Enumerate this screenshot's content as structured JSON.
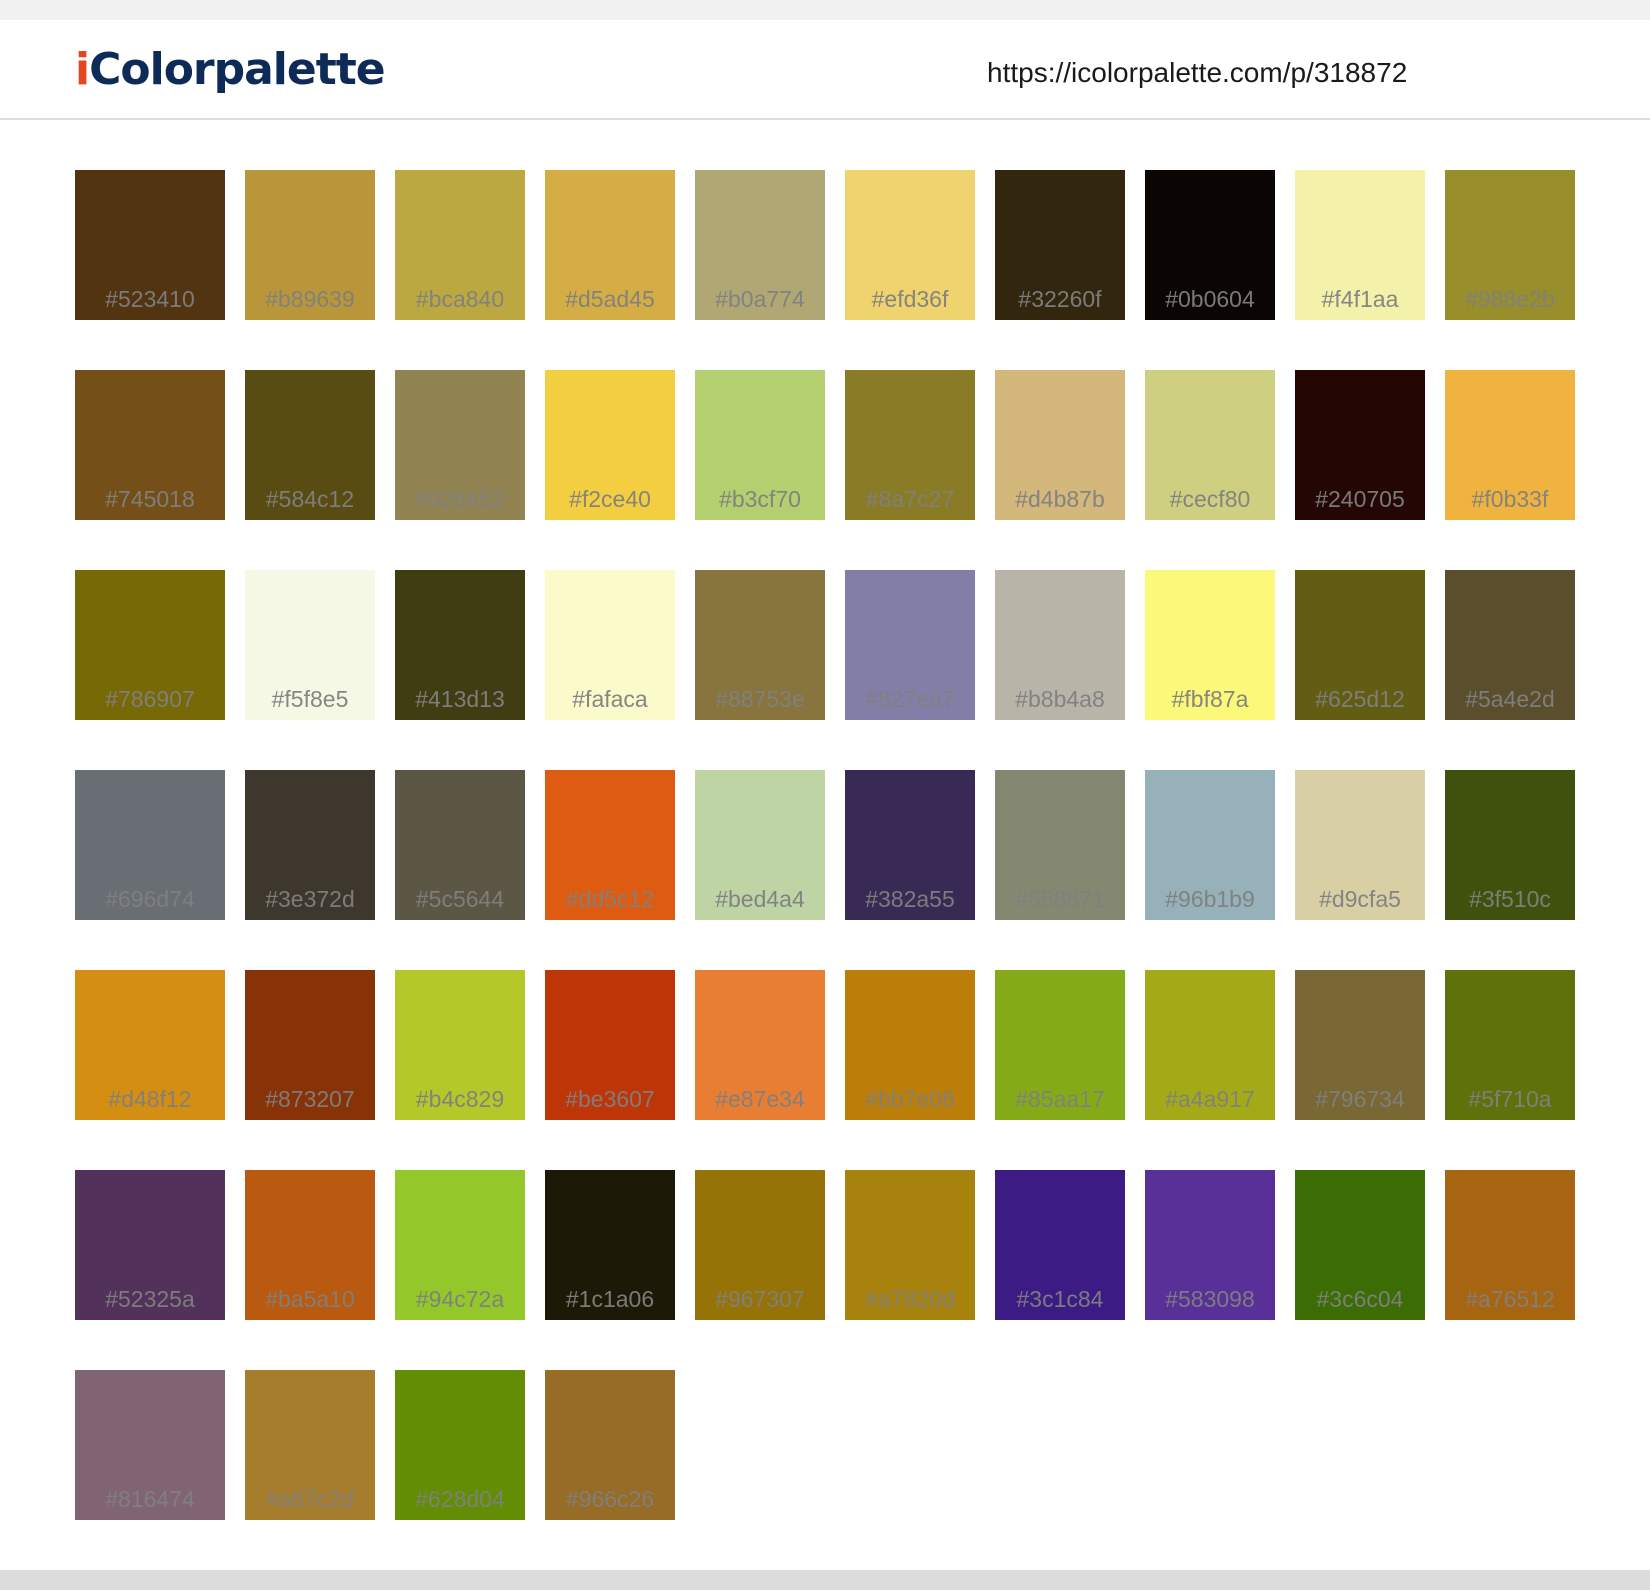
{
  "header": {
    "logo_i": "i",
    "logo_rest": "Colorpalette",
    "url": "https://icolorpalette.com/p/318872"
  },
  "swatches": [
    "#523410",
    "#b89639",
    "#bca840",
    "#d5ad45",
    "#b0a774",
    "#efd36f",
    "#32260f",
    "#0b0604",
    "#f4f1aa",
    "#988e2b",
    "#745018",
    "#584c12",
    "#928452",
    "#f2ce40",
    "#b3cf70",
    "#8a7c27",
    "#d4b87b",
    "#cecf80",
    "#240705",
    "#f0b33f",
    "#786907",
    "#f5f8e5",
    "#413d13",
    "#fafaca",
    "#88753e",
    "#827ea7",
    "#b8b4a8",
    "#fbf87a",
    "#625d12",
    "#5a4e2d",
    "#696d74",
    "#3e372d",
    "#5c5644",
    "#dd5c12",
    "#bed4a4",
    "#382a55",
    "#858871",
    "#96b1b9",
    "#d9cfa5",
    "#3f510c",
    "#d48f12",
    "#873207",
    "#b4c829",
    "#be3607",
    "#e87e34",
    "#bb7e08",
    "#85aa17",
    "#a4a917",
    "#796734",
    "#5f710a",
    "#52325a",
    "#ba5a10",
    "#94c72a",
    "#1c1a06",
    "#967307",
    "#a7820d",
    "#3c1c84",
    "#583098",
    "#3c6c04",
    "#a76512",
    "#816474",
    "#a67c2d",
    "#628d04",
    "#966c26"
  ]
}
